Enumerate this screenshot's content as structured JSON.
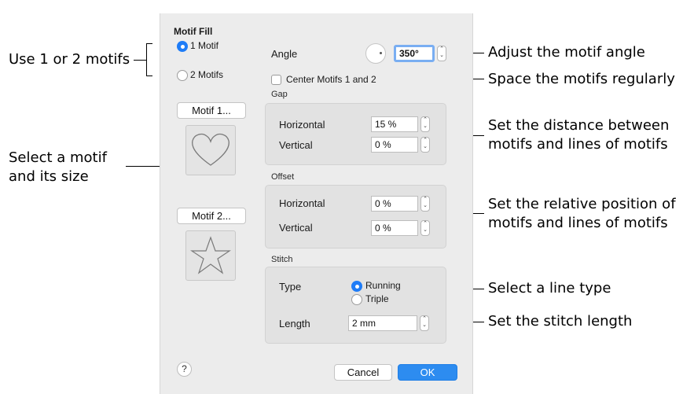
{
  "callouts": {
    "motifs_count": "Use 1 or 2 motifs",
    "select_motif": "Select a motif\nand its size",
    "angle": "Adjust the motif angle",
    "center": "Space the motifs regularly",
    "gap": "Set the distance between\nmotifs and lines of motifs",
    "offset": "Set the relative position of\nmotifs and lines of motifs",
    "line_type": "Select a line type",
    "stitch_length": "Set the stitch length"
  },
  "dialog": {
    "title": "Motif Fill",
    "motif_options": [
      {
        "label": "1 Motif",
        "selected": true
      },
      {
        "label": "2 Motifs",
        "selected": false
      }
    ],
    "motif1_button": "Motif 1...",
    "motif2_button": "Motif 2...",
    "motif1_icon": "heart-icon",
    "motif2_icon": "star-icon",
    "angle": {
      "label": "Angle",
      "value": "350°"
    },
    "center_motifs": {
      "label": "Center Motifs 1 and 2",
      "checked": false
    },
    "gap": {
      "title": "Gap",
      "horizontal_label": "Horizontal",
      "horizontal_value": "15 %",
      "vertical_label": "Vertical",
      "vertical_value": "0 %"
    },
    "offset": {
      "title": "Offset",
      "horizontal_label": "Horizontal",
      "horizontal_value": "0 %",
      "vertical_label": "Vertical",
      "vertical_value": "0 %"
    },
    "stitch": {
      "title": "Stitch",
      "type_label": "Type",
      "options": [
        {
          "label": "Running",
          "selected": true
        },
        {
          "label": "Triple",
          "selected": false
        }
      ],
      "length_label": "Length",
      "length_value": "2 mm"
    },
    "help_label": "?",
    "cancel_label": "Cancel",
    "ok_label": "OK"
  },
  "colors": {
    "accent": "#2d8cf0",
    "dialog_bg": "#ececec",
    "group_bg": "#e2e2e2"
  }
}
